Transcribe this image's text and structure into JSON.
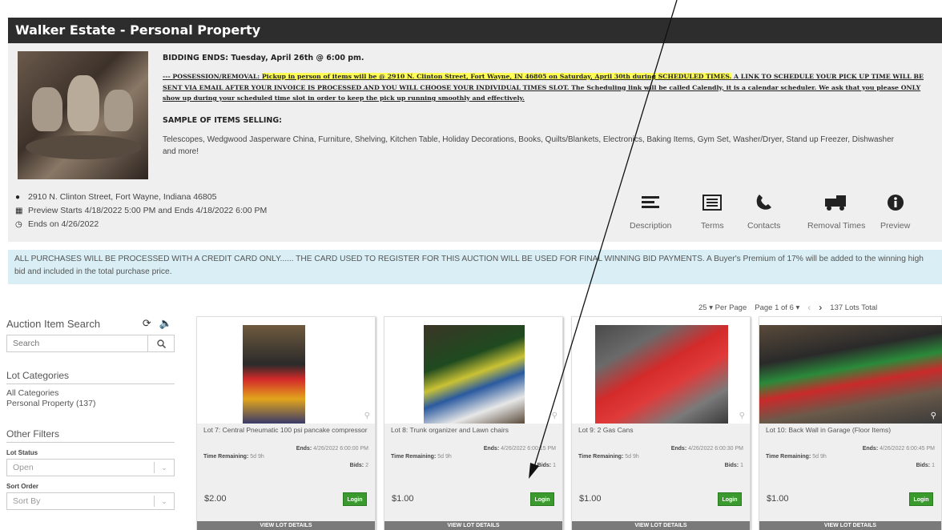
{
  "header": {
    "title": "Walker Estate - Personal Property"
  },
  "info": {
    "bidding_ends": "BIDDING ENDS: Tuesday, April 26th @ 6:00 pm.",
    "possession_prefix": "--- POSSESSION/REMOVAL: ",
    "possession_highlight": "Pickup in person of items will be @ 2910 N. Clinton Street, Fort Wayne, IN 46805 on Saturday, April 30th during SCHEDULED TIMES.",
    "possession_rest": " A LINK TO SCHEDULE YOUR PICK UP TIME WILL BE SENT VIA EMAIL AFTER YOUR INVOICE IS PROCESSED AND YOU WILL CHOOSE YOUR INDIVIDUAL TIMES SLOT. The Scheduling link will be called Calendly, it is a calendar scheduler. We ask that you please ONLY show up during your scheduled time slot in order to keep the pick up running smoothly and effectively.",
    "sample_heading": "SAMPLE OF ITEMS SELLING:",
    "sample_list": "Telescopes, Wedgwood Jasperware China, Furniture, Shelving, Kitchen Table, Holiday Decorations, Books, Quilts/Blankets, Electronics, Baking Items, Gym Set, Washer/Dryer, Stand up Freezer, Dishwasher and more!",
    "address": "2910 N. Clinton Street, Fort Wayne, Indiana 46805",
    "preview": "Preview Starts 4/18/2022 5:00 PM and Ends 4/18/2022 6:00 PM",
    "ends_on": "Ends on 4/26/2022"
  },
  "tools": {
    "description": "Description",
    "terms": "Terms",
    "contacts": "Contacts",
    "removal_times": "Removal Times",
    "preview": "Preview"
  },
  "notice": "ALL PURCHASES WILL BE PROCESSED WITH A CREDIT CARD ONLY...... THE CARD USED TO REGISTER FOR THIS AUCTION WILL BE USED FOR FINAL WINNING BID PAYMENTS. A Buyer's Premium of 17% will be added to the winning high bid and included in the total purchase price.",
  "pager": {
    "per_page": "25",
    "per_page_label": "Per Page",
    "page_label": "Page 1 of 6",
    "lots_total": "137 Lots Total"
  },
  "sidebar": {
    "search_title": "Auction Item Search",
    "search_placeholder": "Search",
    "categories_title": "Lot Categories",
    "all_categories": "All Categories",
    "personal_property": "Personal Property (137)",
    "other_filters": "Other Filters",
    "lot_status_label": "Lot Status",
    "lot_status_value": "Open",
    "sort_order_label": "Sort Order",
    "sort_order_value": "Sort By"
  },
  "lots": [
    {
      "title": "Lot 7:  Central Pneumatic 100 psi pancake compressor",
      "ends_label": "Ends:",
      "ends": "4/26/2022 6:00:00 PM",
      "time_label": "Time Remaining:",
      "time": "5d  9h",
      "bids_label": "Bids:",
      "bids": "2",
      "price": "$2.00",
      "login": "Login",
      "view": "VIEW LOT DETAILS"
    },
    {
      "title": "Lot 8:  Trunk organizer and Lawn chairs",
      "ends_label": "Ends:",
      "ends": "4/26/2022 6:00:15 PM",
      "time_label": "Time Remaining:",
      "time": "5d  9h",
      "bids_label": "Bids:",
      "bids": "1",
      "price": "$1.00",
      "login": "Login",
      "view": "VIEW LOT DETAILS"
    },
    {
      "title": "Lot 9:  2 Gas Cans",
      "ends_label": "Ends:",
      "ends": "4/26/2022 6:00:30 PM",
      "time_label": "Time Remaining:",
      "time": "5d  9h",
      "bids_label": "Bids:",
      "bids": "1",
      "price": "$1.00",
      "login": "Login",
      "view": "VIEW LOT DETAILS"
    },
    {
      "title": "Lot 10:  Back Wall in Garage (Floor Items)",
      "ends_label": "Ends:",
      "ends": "4/26/2022 6:00:45 PM",
      "time_label": "Time Remaining:",
      "time": "5d  9h",
      "bids_label": "Bids:",
      "bids": "1",
      "price": "$1.00",
      "login": "Login",
      "view": "VIEW LOT DETAILS"
    }
  ],
  "colors": {
    "header_bg": "#2d2d2d",
    "notice_bg": "#d9eff5",
    "login_green": "#3a9a2e",
    "highlight": "#ffff55"
  }
}
